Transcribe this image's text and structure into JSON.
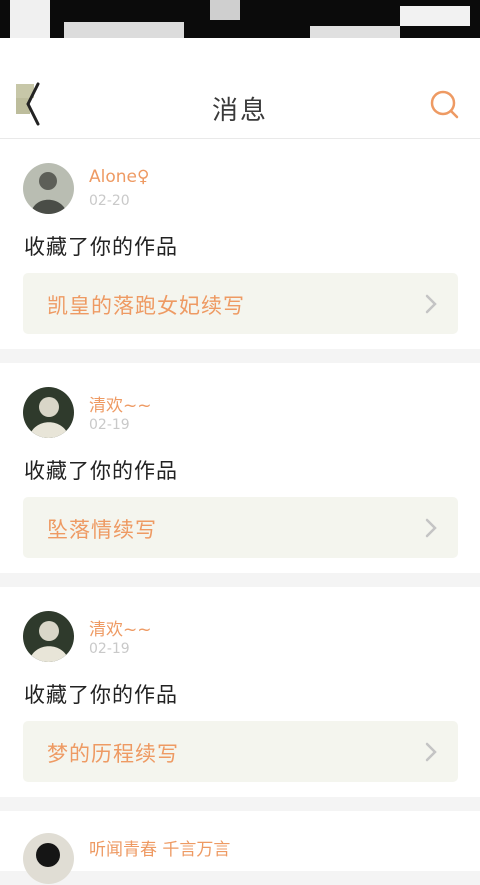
{
  "header": {
    "title": "消息"
  },
  "colors": {
    "accent": "#ee9a63",
    "work_bg": "#f4f5ee",
    "page_bg": "#f4f4f4"
  },
  "notifications": [
    {
      "username": "Alone♀",
      "date": "02-20",
      "action": "收藏了你的作品",
      "work_title": "凯皇的落跑女妃续写"
    },
    {
      "username": "清欢~~",
      "date": "02-19",
      "action": "收藏了你的作品",
      "work_title": "坠落情续写"
    },
    {
      "username": "清欢~~",
      "date": "02-19",
      "action": "收藏了你的作品",
      "work_title": "梦的历程续写"
    },
    {
      "username": "听闻青春 千言万言"
    }
  ]
}
